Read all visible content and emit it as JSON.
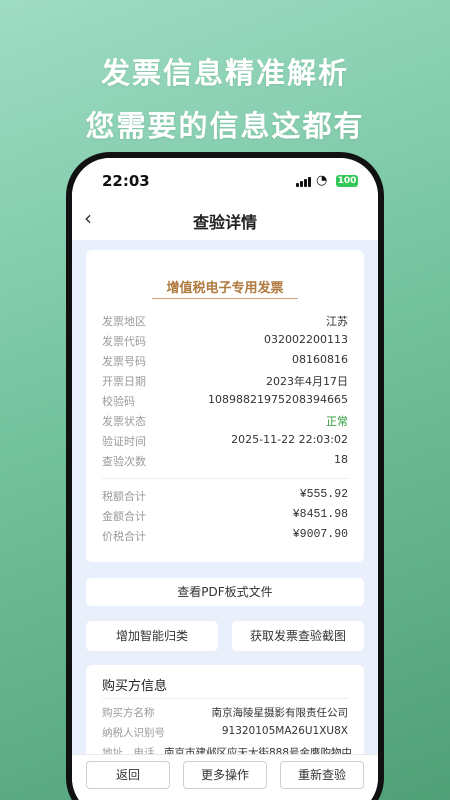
{
  "promo": {
    "headline1": "发票信息精准解析",
    "headline2": "您需要的信息这都有"
  },
  "status_bar": {
    "time": "22:03",
    "battery": "100"
  },
  "nav": {
    "title": "查验详情"
  },
  "invoice": {
    "title": "增值税电子专用发票",
    "fields": [
      {
        "label": "发票地区",
        "value": "江苏"
      },
      {
        "label": "发票代码",
        "value": "032002200113"
      },
      {
        "label": "发票号码",
        "value": "08160816"
      },
      {
        "label": "开票日期",
        "value": "2023年4月17日"
      },
      {
        "label": "校验码",
        "value": "10898821975208394665"
      },
      {
        "label": "发票状态",
        "value": "正常"
      },
      {
        "label": "验证时间",
        "value": "2025-11-22 22:03:02"
      },
      {
        "label": "查验次数",
        "value": "18"
      }
    ],
    "totals": [
      {
        "label": "税额合计",
        "value": "¥555.92"
      },
      {
        "label": "金额合计",
        "value": "¥8451.98"
      },
      {
        "label": "价税合计",
        "value": "¥9007.90"
      }
    ]
  },
  "actions": {
    "view_pdf": "查看PDF板式文件",
    "add_category": "增加智能归类",
    "get_screenshot": "获取发票查验截图"
  },
  "buyer": {
    "title": "购买方信息",
    "fields": [
      {
        "label": "购买方名称",
        "value": "南京海陵星摄影有限责任公司"
      },
      {
        "label": "纳税人识别号",
        "value": "91320105MA26U1XU8X"
      },
      {
        "label": "地址、电话",
        "value": "南京市建邺区应天大街888号金鹰购物中"
      }
    ]
  },
  "bottom": {
    "back": "返回",
    "more": "更多操作",
    "recheck": "重新查验"
  },
  "colors": {
    "accent_green": "#2e9b3b",
    "invoice_title": "#b07a3e",
    "battery": "#34c759"
  }
}
